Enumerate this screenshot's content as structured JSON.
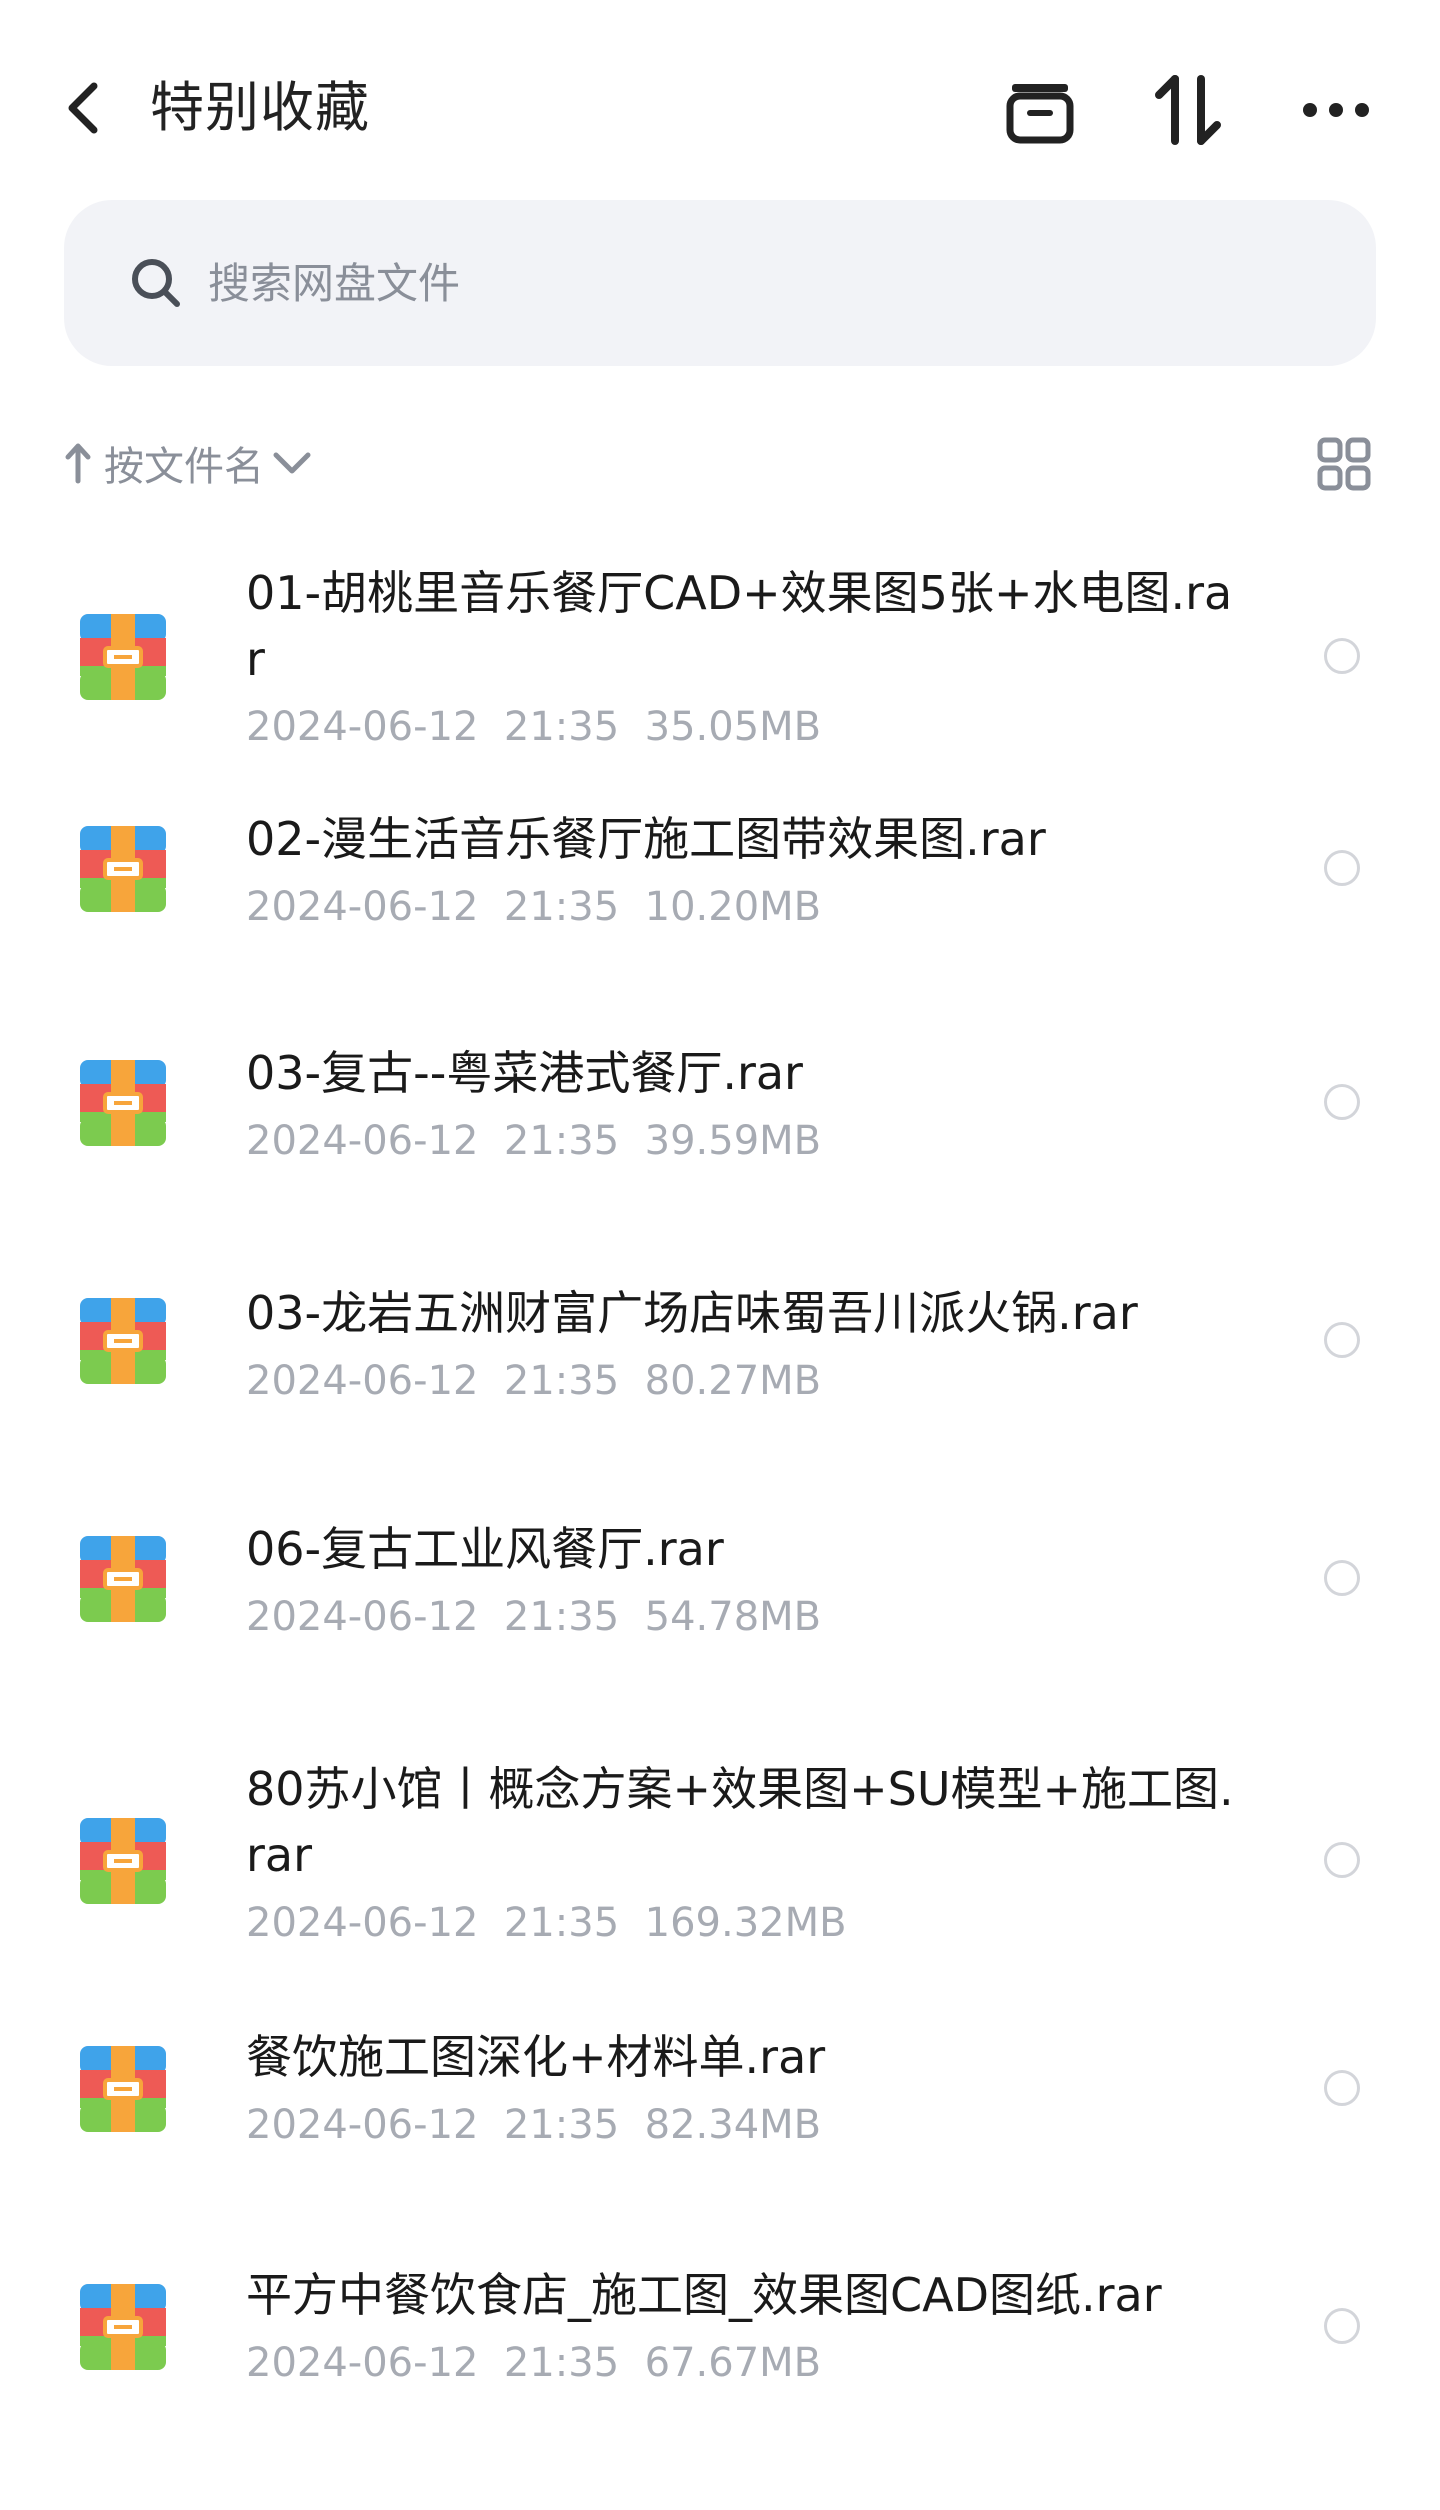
{
  "header": {
    "title": "特别收藏"
  },
  "search": {
    "placeholder": "搜索网盘文件"
  },
  "sortbar": {
    "label": "按文件名"
  },
  "files": [
    {
      "name": "01-胡桃里音乐餐厅CAD+效果图5张+水电图.rar",
      "date": "2024-06-12",
      "time": "21:35",
      "size": "35.05MB"
    },
    {
      "name": "02-漫生活音乐餐厅施工图带效果图.rar",
      "date": "2024-06-12",
      "time": "21:35",
      "size": "10.20MB"
    },
    {
      "name": "03-复古--粤菜港式餐厅.rar",
      "date": "2024-06-12",
      "time": "21:35",
      "size": "39.59MB"
    },
    {
      "name": "03-龙岩五洲财富广场店味蜀吾川派火锅.rar",
      "date": "2024-06-12",
      "time": "21:35",
      "size": "80.27MB"
    },
    {
      "name": "06-复古工业风餐厅.rar",
      "date": "2024-06-12",
      "time": "21:35",
      "size": "54.78MB"
    },
    {
      "name": "80苏小馆丨概念方案+效果图+SU模型+施工图.rar",
      "date": "2024-06-12",
      "time": "21:35",
      "size": "169.32MB"
    },
    {
      "name": "餐饮施工图深化+材料单.rar",
      "date": "2024-06-12",
      "time": "21:35",
      "size": "82.34MB"
    },
    {
      "name": "平方中餐饮食店_施工图_效果图CAD图纸.rar",
      "date": "2024-06-12",
      "time": "21:35",
      "size": "67.67MB"
    }
  ],
  "colors": {
    "archive_blue": "#3fa3ea",
    "archive_red": "#ee5a55",
    "archive_green": "#7ccb4f",
    "archive_band": "#f7a53b"
  },
  "icons": {
    "back": "chevron-left-icon",
    "archive": "archive-box-icon",
    "sort": "sort-arrows-icon",
    "more": "more-dots-icon",
    "search": "search-icon",
    "sort_direction": "arrow-up-icon",
    "dropdown": "chevron-down-icon",
    "grid": "grid-view-icon",
    "file": "rar-archive-icon"
  }
}
